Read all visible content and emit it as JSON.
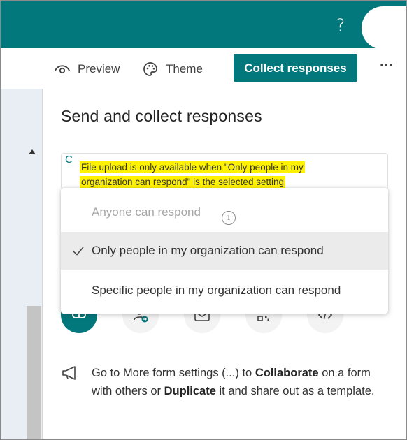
{
  "header": {
    "help_label": "?",
    "accent_color": "#03787c"
  },
  "toolbar": {
    "preview_label": "Preview",
    "theme_label": "Theme",
    "collect_label": "Collect responses",
    "more_label": "···"
  },
  "panel": {
    "title": "Send and collect responses",
    "select_prefix": "C",
    "tooltip_line1": "File upload is only available when \"Only people in my",
    "tooltip_line2": "organization can respond\" is the selected setting",
    "options": [
      {
        "label": "Anyone can respond",
        "state": "disabled"
      },
      {
        "label": "Only people in my organization can respond",
        "state": "selected"
      },
      {
        "label": "Specific people in my organization can respond",
        "state": "normal"
      }
    ],
    "share_icons": [
      "link-icon",
      "people-send-icon",
      "mail-icon",
      "qr-code-icon",
      "embed-code-icon"
    ]
  },
  "tip": {
    "part1": "Go to More form settings (...) to ",
    "bold1": "Collaborate",
    "part2": " on a form with others or ",
    "bold2": "Duplicate",
    "part3": " it and share out as a template."
  }
}
